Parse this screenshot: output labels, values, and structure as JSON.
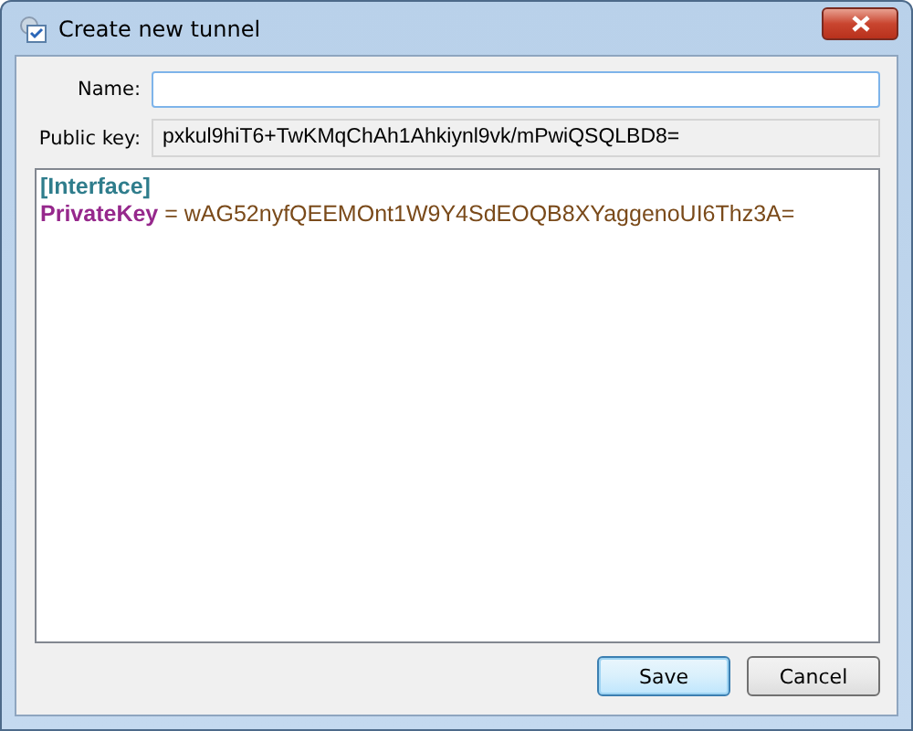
{
  "window": {
    "title": "Create new tunnel"
  },
  "name_field": {
    "label": "Name:"
  },
  "public_key": {
    "label": "Public key:",
    "value": "pxkul9hiT6+TwKMqChAh1Ahkiynl9vk/mPwiQSQLBD8="
  },
  "editor": {
    "lines": [
      [
        {
          "kind": "section",
          "text": "[Interface]"
        }
      ],
      [
        {
          "kind": "key",
          "text": "PrivateKey"
        },
        {
          "kind": "value",
          "text": " = wAG52nyfQEEMOnt1W9Y4SdEOQB8XYaggenoUI6Thz3A="
        }
      ]
    ]
  },
  "buttons": [
    {
      "label": "Save",
      "default": true
    },
    {
      "label": "Cancel",
      "default": false
    }
  ]
}
